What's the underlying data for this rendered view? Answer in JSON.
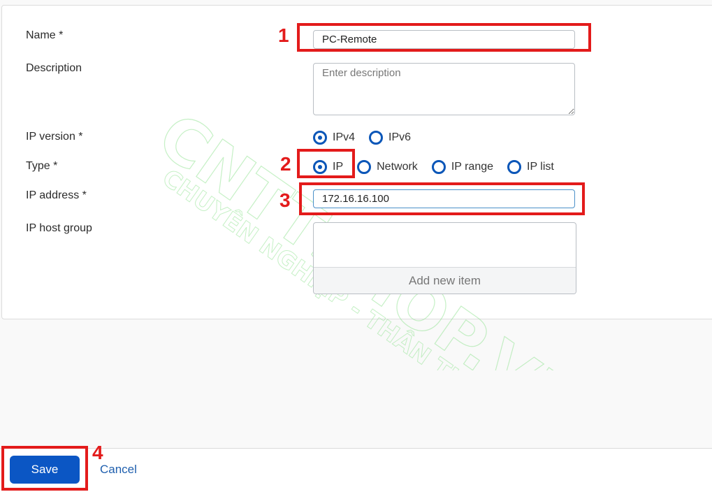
{
  "form": {
    "name": {
      "label": "Name *",
      "value": "PC-Remote"
    },
    "description": {
      "label": "Description",
      "placeholder": "Enter description",
      "value": ""
    },
    "ip_version": {
      "label": "IP version *",
      "options": [
        {
          "label": "IPv4",
          "checked": true
        },
        {
          "label": "IPv6",
          "checked": false
        }
      ]
    },
    "type": {
      "label": "Type *",
      "options": [
        {
          "label": "IP",
          "checked": true
        },
        {
          "label": "Network",
          "checked": false
        },
        {
          "label": "IP range",
          "checked": false
        },
        {
          "label": "IP list",
          "checked": false
        }
      ]
    },
    "ip_address": {
      "label": "IP address *",
      "value": "172.16.16.100"
    },
    "ip_host_group": {
      "label": "IP host group",
      "add_label": "Add new item"
    }
  },
  "footer": {
    "save_label": "Save",
    "cancel_label": "Cancel"
  },
  "annotations": {
    "step1": "1",
    "step2": "2",
    "step3": "3",
    "step4": "4",
    "color": "#e31b1b"
  },
  "watermark": {
    "line1": "CNTTSHOP.VN",
    "line2": "CHUYÊN NGHIỆP - THÂN THIỆN"
  },
  "colors": {
    "accent": "#0b56c4",
    "radio": "#0b56b8",
    "link": "#1f5fae"
  }
}
